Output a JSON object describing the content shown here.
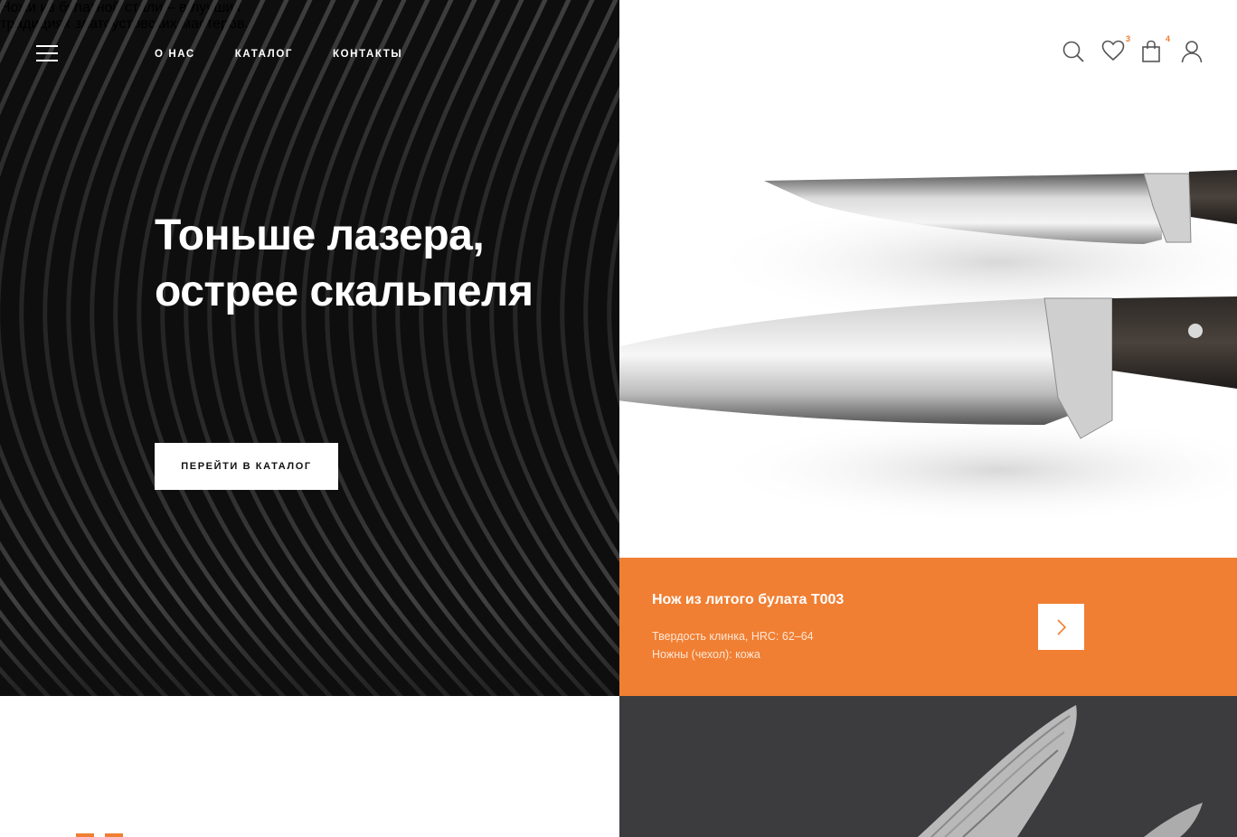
{
  "nav": {
    "menu_icon": "hamburger-menu-icon",
    "links": [
      "О НАС",
      "КАТАЛОГ",
      "КОНТАКТЫ"
    ]
  },
  "header_icons": {
    "search": "search-icon",
    "favorites": {
      "icon": "heart-icon",
      "count": "3"
    },
    "cart": {
      "icon": "shopping-bag-icon",
      "count": "4"
    },
    "account": "user-icon"
  },
  "hero": {
    "title_line1": "Тоньше лазера,",
    "title_line2": "острее скальпеля",
    "subtitle_line1": "Ножи из булатной стали – в лучших",
    "subtitle_line2": "традициях златоустовских мастеров.",
    "cta_label": "ПЕРЕЙТИ В КАТАЛОГ"
  },
  "product_card": {
    "name": "Нож из литого булата Т003",
    "spec_1": "Твердость клинка, HRC: 62–64",
    "spec_2": "Ножны (чехол): кожа",
    "next_icon": "chevron-right-icon"
  },
  "colors": {
    "accent": "#f07f33",
    "dark": "#0e0e0e",
    "white": "#ffffff"
  }
}
